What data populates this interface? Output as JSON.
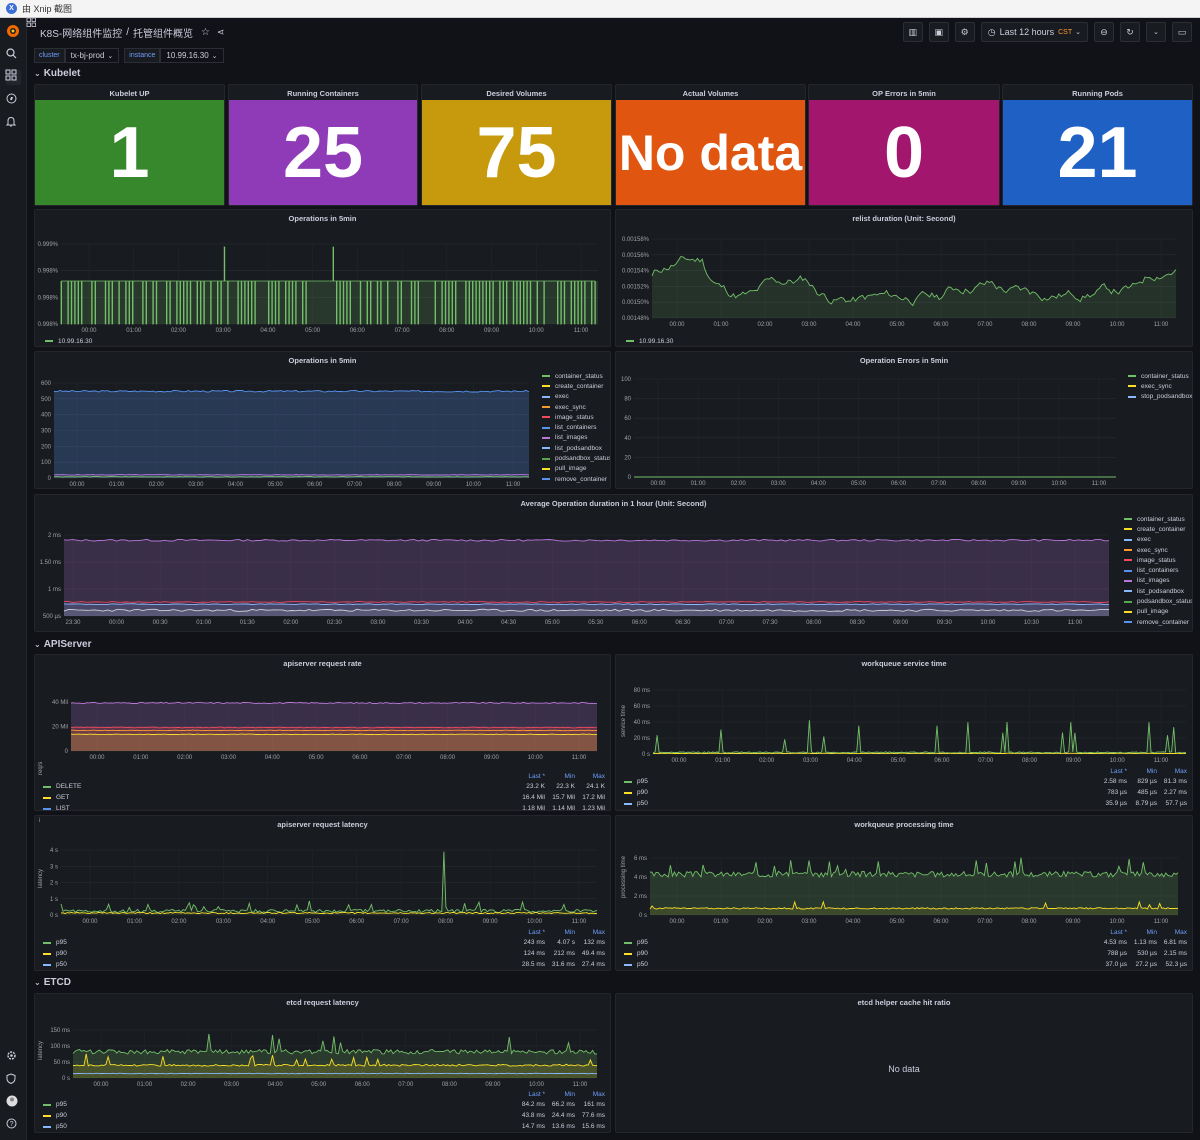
{
  "window": {
    "title": "由 Xnip 截图"
  },
  "breadcrumb": {
    "folder": "K8S-网络组件监控",
    "separator": "/",
    "dashboard": "托管组件概览"
  },
  "topbar": {
    "time_range": "Last 12 hours",
    "timezone": "CST"
  },
  "variables": [
    {
      "label": "cluster",
      "value": "tx-bj-prod"
    },
    {
      "label": "instance",
      "value": "10.99.16.30"
    }
  ],
  "rows": {
    "kubelet": "Kubelet",
    "apiserver": "APIServer",
    "etcd": "ETCD"
  },
  "stats": [
    {
      "title": "Kubelet UP",
      "value": "1",
      "color": "#37872d"
    },
    {
      "title": "Running Containers",
      "value": "25",
      "color": "#8f3bb8"
    },
    {
      "title": "Desired Volumes",
      "value": "75",
      "color": "#c69a0c"
    },
    {
      "title": "Actual Volumes",
      "value": "No data",
      "color": "#e0550f"
    },
    {
      "title": "OP Errors in 5min",
      "value": "0",
      "color": "#a3166e"
    },
    {
      "title": "Running Pods",
      "value": "21",
      "color": "#1f60c4"
    }
  ],
  "colors": {
    "green": "#73bf69",
    "yellow": "#fade2a",
    "blue": "#5794f2",
    "orange": "#ff9830",
    "red": "#f2495c",
    "lblue": "#8ab8ff",
    "purple": "#b877d9",
    "dgreen": "#56a64b"
  },
  "hours12": [
    "00:00",
    "01:00",
    "02:00",
    "03:00",
    "04:00",
    "05:00",
    "06:00",
    "07:00",
    "08:00",
    "09:00",
    "10:00",
    "11:00"
  ],
  "panels": {
    "ops_top": {
      "title": "Operations in 5min",
      "y_ticks": [
        "0.999%",
        "0.998%",
        "0.998%",
        "0.998%"
      ],
      "legend": "10.99.16.30"
    },
    "relist": {
      "title": "relist duration (Unit: Second)",
      "y_ticks": [
        "0.00158%",
        "0.00156%",
        "0.00154%",
        "0.00152%",
        "0.00150%",
        "0.00148%"
      ],
      "legend": "10.99.16.30"
    },
    "ops_mid": {
      "title": "Operations in 5min",
      "y_ticks": [
        "600",
        "500",
        "400",
        "300",
        "200",
        "100",
        "0"
      ],
      "legend": [
        "container_status",
        "create_container",
        "exec",
        "exec_sync",
        "image_status",
        "list_containers",
        "list_images",
        "list_podsandbox",
        "podsandbox_status",
        "pull_image",
        "remove_container"
      ]
    },
    "op_err": {
      "title": "Operation Errors in 5min",
      "y_ticks": [
        "100",
        "80",
        "60",
        "40",
        "20",
        "0"
      ],
      "legend": [
        "container_status",
        "exec_sync",
        "stop_podsandbox"
      ]
    },
    "avg_op": {
      "title": "Average Operation duration in 1 hour (Unit: Second)",
      "y_ticks": [
        "2 ms",
        "1.50 ms",
        "1 ms",
        "500 µs"
      ],
      "x_ticks": [
        "23:30",
        "00:00",
        "00:30",
        "01:00",
        "01:30",
        "02:00",
        "02:30",
        "03:00",
        "03:30",
        "04:00",
        "04:30",
        "05:00",
        "05:30",
        "06:00",
        "06:30",
        "07:00",
        "07:30",
        "08:00",
        "08:30",
        "09:00",
        "09:30",
        "10:00",
        "10:30",
        "11:00"
      ],
      "legend": [
        "container_status",
        "create_container",
        "exec",
        "exec_sync",
        "image_status",
        "list_containers",
        "list_images",
        "list_podsandbox",
        "podsandbox_status",
        "pull_image",
        "remove_container"
      ]
    },
    "api_rate": {
      "title": "apiserver request rate",
      "ylabel": "req/s",
      "y_ticks": [
        "40 Mil",
        "20 Mil",
        "0"
      ],
      "header": [
        "",
        "Last *",
        "Min",
        "Max"
      ],
      "rows": [
        [
          "DELETE",
          "23.2 K",
          "22.3 K",
          "24.1 K"
        ],
        [
          "GET",
          "16.4 Mil",
          "15.7 Mil",
          "17.2 Mil"
        ],
        [
          "LIST",
          "1.18 Mil",
          "1.14 Mil",
          "1.23 Mil"
        ]
      ]
    },
    "wq_service": {
      "title": "workqueue service time",
      "ylabel": "service time",
      "y_ticks": [
        "80 ms",
        "60 ms",
        "40 ms",
        "20 ms",
        "0 s"
      ],
      "header": [
        "",
        "Last *",
        "Min",
        "Max"
      ],
      "rows": [
        [
          "p95",
          "2.58 ms",
          "829 µs",
          "81.3 ms"
        ],
        [
          "p90",
          "783 µs",
          "485 µs",
          "2.27 ms"
        ],
        [
          "p50",
          "35.9 µs",
          "8.79 µs",
          "57.7 µs"
        ]
      ]
    },
    "api_lat": {
      "title": "apiserver request latency",
      "ylabel": "latency",
      "y_ticks": [
        "4 s",
        "3 s",
        "2 s",
        "1 s",
        "0 s"
      ],
      "header": [
        "",
        "Last *",
        "Min",
        "Max"
      ],
      "rows": [
        [
          "p95",
          "243 ms",
          "4.07 s",
          "132 ms"
        ],
        [
          "p90",
          "124 ms",
          "212 ms",
          "49.4 ms"
        ],
        [
          "p50",
          "28.5 ms",
          "31.6 ms",
          "27.4 ms"
        ]
      ]
    },
    "wq_proc": {
      "title": "workqueue processing time",
      "ylabel": "processing time",
      "y_ticks": [
        "6 ms",
        "4 ms",
        "2 ms",
        "0 s"
      ],
      "header": [
        "",
        "Last *",
        "Min",
        "Max"
      ],
      "rows": [
        [
          "p95",
          "4.53 ms",
          "1.13 ms",
          "6.81 ms"
        ],
        [
          "p90",
          "788 µs",
          "530 µs",
          "2.15 ms"
        ],
        [
          "p50",
          "37.0 µs",
          "27.2 µs",
          "52.3 µs"
        ]
      ]
    },
    "etcd_lat": {
      "title": "etcd request latency",
      "ylabel": "latency",
      "y_ticks": [
        "150 ms",
        "100 ms",
        "50 ms",
        "0 s"
      ],
      "header": [
        "",
        "Last *",
        "Min",
        "Max"
      ],
      "rows": [
        [
          "p95",
          "84.2 ms",
          "66.2 ms",
          "161 ms"
        ],
        [
          "p90",
          "43.8 ms",
          "24.4 ms",
          "77.6 ms"
        ],
        [
          "p50",
          "14.7 ms",
          "13.6 ms",
          "15.6 ms"
        ]
      ]
    },
    "etcd_cache": {
      "title": "etcd helper cache hit ratio",
      "no_data": "No data"
    }
  }
}
